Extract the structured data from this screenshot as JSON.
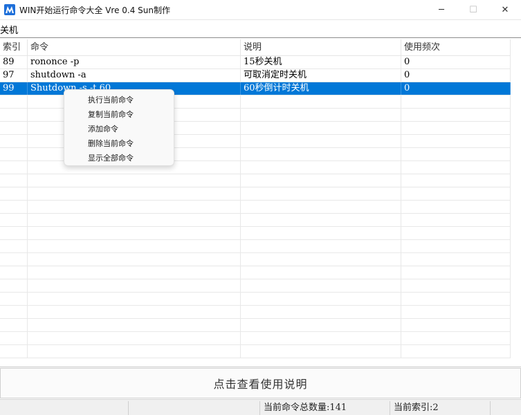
{
  "window": {
    "title": "WIN开始运行命令大全 Vre 0.4   Sun制作",
    "icon": "app-logo-icon",
    "controls": {
      "minimize": "─",
      "maximize": "☐",
      "close": "✕"
    }
  },
  "filter": {
    "value": "关机"
  },
  "list": {
    "columns": [
      "索引",
      "命令",
      "说明",
      "使用频次"
    ],
    "rows": [
      [
        "89",
        "rononce -p",
        "15秒关机",
        "0"
      ],
      [
        "97",
        "shutdown -a",
        "可取消定时关机",
        "0"
      ],
      [
        "99",
        "Shutdown -s -t 60",
        "60秒倒计时关机",
        "0"
      ]
    ],
    "selected_row": 2
  },
  "context_menu": {
    "items": [
      "执行当前命令",
      "复制当前命令",
      "添加命令",
      "删除当前命令",
      "显示全部命令"
    ]
  },
  "help_button": {
    "label": "点击查看使用说明"
  },
  "statusbar": {
    "total_label": "当前命令总数量:141",
    "index_label": "当前索引:2"
  },
  "colors": {
    "selection": "#0078d7",
    "icon_bg": "#1e6fd9"
  }
}
